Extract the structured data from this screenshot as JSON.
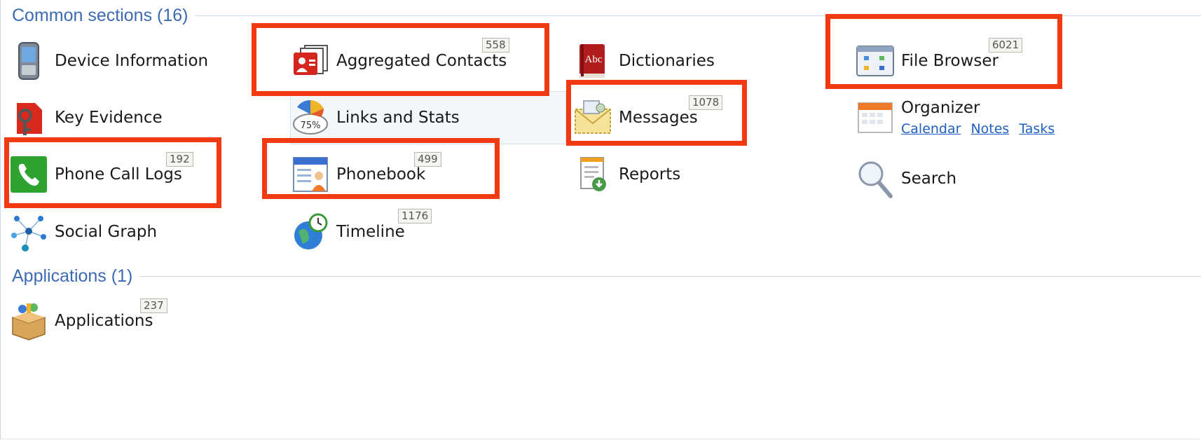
{
  "common_sections": {
    "header": "Common sections (16)",
    "items": {
      "device_information": {
        "label": "Device Information",
        "icon": "phone-device-icon"
      },
      "aggregated_contacts": {
        "label": "Aggregated Contacts",
        "count": "558",
        "icon": "contact-cards-icon"
      },
      "dictionaries": {
        "label": "Dictionaries",
        "icon": "dictionary-book-icon",
        "icon_text": "Abc"
      },
      "file_browser": {
        "label": "File Browser",
        "count": "6021",
        "icon": "file-browser-window-icon"
      },
      "key_evidence": {
        "label": "Key Evidence",
        "icon": "key-tag-icon"
      },
      "links_and_stats": {
        "label": "Links and Stats",
        "icon": "pie-chart-icon",
        "icon_text": "75%"
      },
      "messages": {
        "label": "Messages",
        "count": "1078",
        "icon": "envelope-icon"
      },
      "organizer": {
        "label": "Organizer",
        "icon": "calendar-icon",
        "links": {
          "calendar": "Calendar",
          "notes": "Notes",
          "tasks": "Tasks"
        }
      },
      "phone_call_logs": {
        "label": "Phone Call Logs",
        "count": "192",
        "icon": "phone-handset-icon"
      },
      "phonebook": {
        "label": "Phonebook",
        "count": "499",
        "icon": "phonebook-icon"
      },
      "reports": {
        "label": "Reports",
        "icon": "report-document-icon"
      },
      "search": {
        "label": "Search",
        "icon": "magnifier-icon"
      },
      "social_graph": {
        "label": "Social Graph",
        "icon": "network-graph-icon"
      },
      "timeline": {
        "label": "Timeline",
        "count": "1176",
        "icon": "globe-clock-icon"
      }
    }
  },
  "applications_section": {
    "header": "Applications (1)",
    "items": {
      "applications": {
        "label": "Applications",
        "count": "237",
        "icon": "package-box-icon"
      }
    }
  },
  "colors": {
    "highlight": "#f23a12",
    "header_text": "#3d6bb3",
    "link": "#1e5fbf"
  }
}
